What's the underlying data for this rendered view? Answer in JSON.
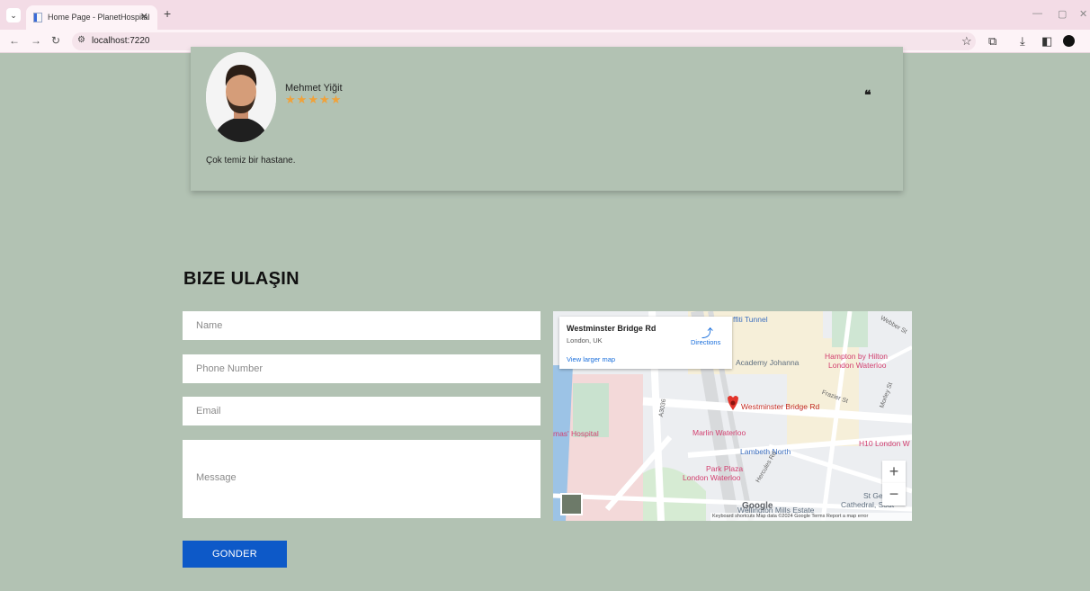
{
  "browser": {
    "tab_title": "Home Page - PlanetHospital",
    "url": "localhost:7220"
  },
  "testimonial": {
    "name": "Mehmet Yiğit",
    "rating": 5,
    "stars": [
      "★",
      "★",
      "★",
      "★",
      "★"
    ],
    "quote_icon": "❝",
    "text": "Çok temiz bir hastane."
  },
  "contact": {
    "title": "BIZE ULAŞIN",
    "name_placeholder": "Name",
    "phone_placeholder": "Phone Number",
    "email_placeholder": "Email",
    "message_placeholder": "Message",
    "submit_label": "GONDER"
  },
  "map": {
    "place_name": "Westminster Bridge Rd",
    "place_address": "London, UK",
    "directions_label": "Directions",
    "larger_map_link": "View larger map",
    "pin_label": "Westminster Bridge Rd",
    "labels": {
      "graffiti_tunnel": "ffiti Tunnel",
      "academy": "Academy Johanna",
      "hampton_line1": "Hampton by Hilton",
      "hampton_line2": "London Waterloo",
      "marlin": "Marlin Waterloo",
      "lambeth": "Lambeth North",
      "h10": "H10 London W",
      "park_plaza_line1": "Park Plaza",
      "park_plaza_line2": "London Waterloo",
      "hospital": "mas' Hospital",
      "wellington": "Wellington Mills Estate",
      "cathedral_line1": "St Ge",
      "cathedral_line2": "Cathedral, Sout",
      "webber": "Webber St",
      "frazier": "Frazier St",
      "morley": "Morley St",
      "a3036": "A3036",
      "hercules": "Hercules Rd"
    },
    "google_logo": "Google",
    "footer": "Keyboard shortcuts   Map data ©2024 Google   Terms   Report a map error",
    "zoom_in": "+",
    "zoom_out": "−"
  },
  "colors": {
    "page_bg": "#b2c2b3",
    "button": "#0d59c8",
    "star": "#f0a23a",
    "map_pin": "#e2342b"
  }
}
